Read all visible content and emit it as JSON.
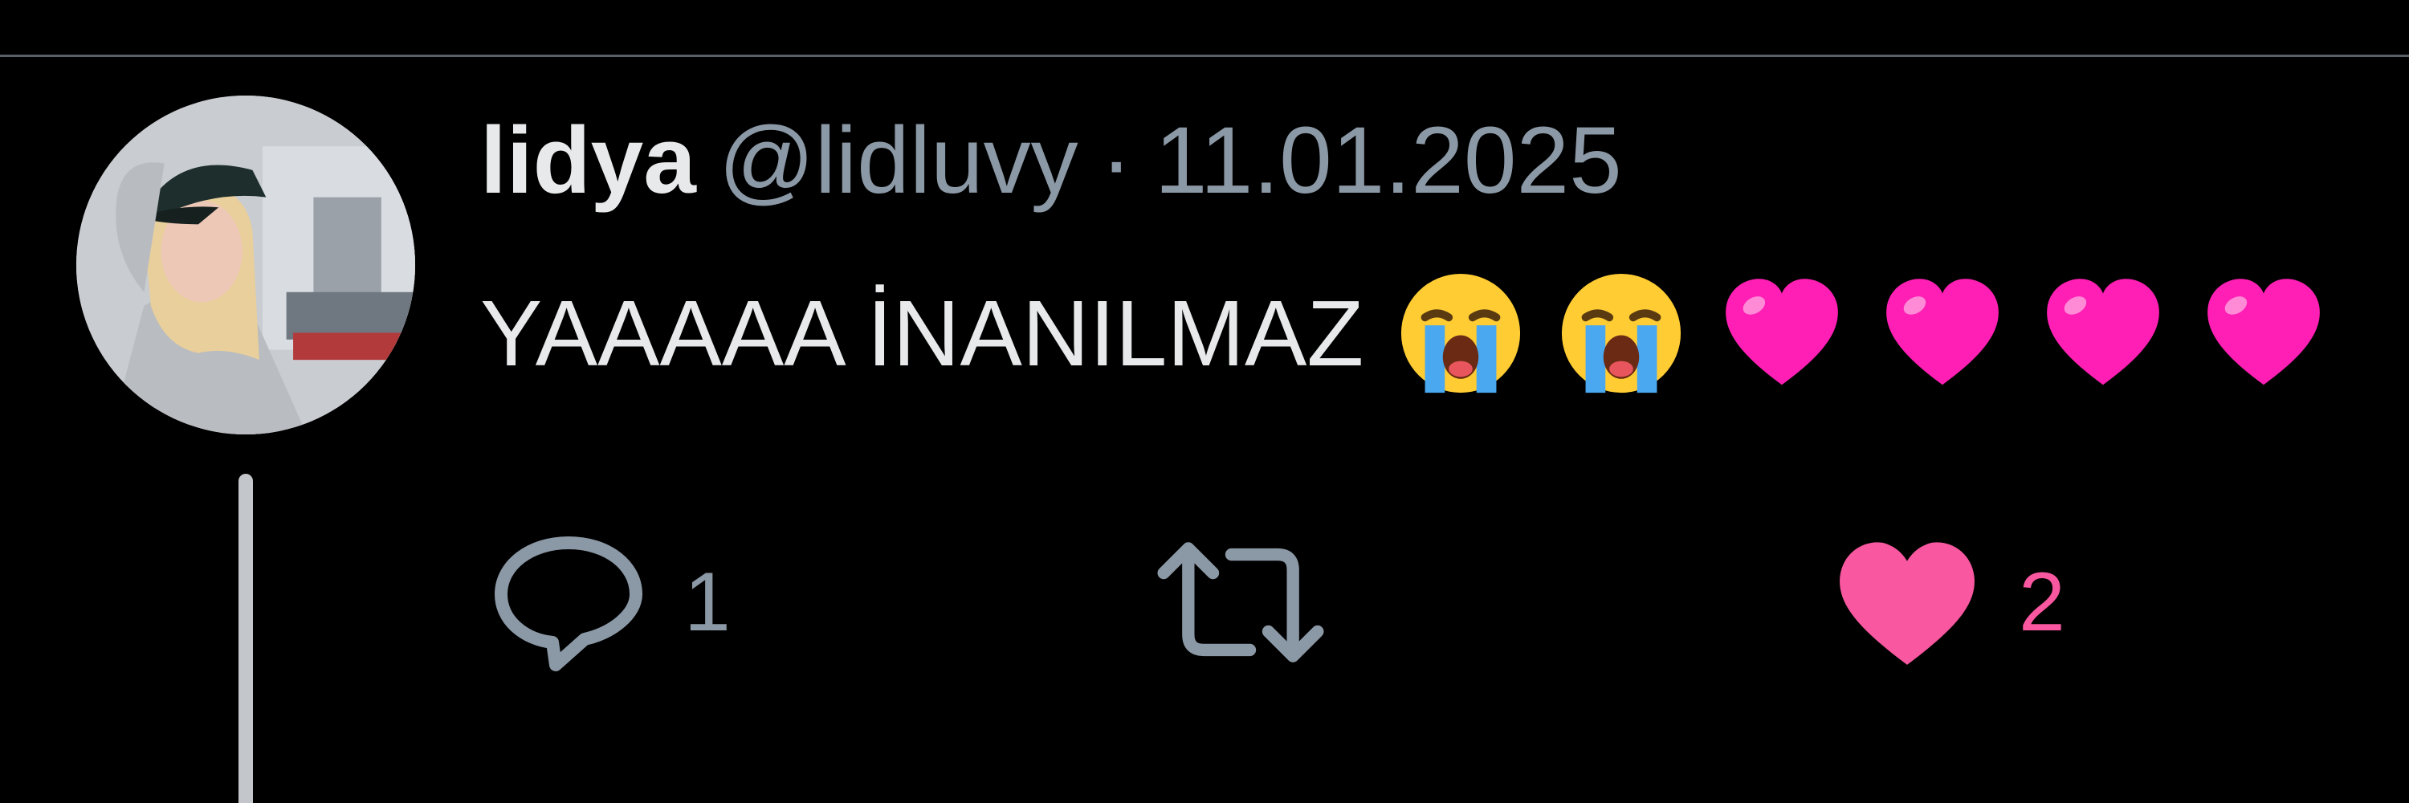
{
  "tweet": {
    "display_name": "lidya",
    "handle": "@lidluvy",
    "separator": "·",
    "date": "11.01.2025",
    "text": "YAAAAA İNANILMAZ",
    "emojis": [
      "loudly-crying-face",
      "loudly-crying-face",
      "pink-heart",
      "pink-heart",
      "pink-heart",
      "pink-heart"
    ]
  },
  "actions": {
    "reply_count": "1",
    "retweet_count": "",
    "like_count": "2"
  },
  "colors": {
    "background": "#000000",
    "primary_text": "#e7e9ea",
    "secondary_text": "#8b98a5",
    "like_pink": "#f9579f",
    "divider": "#5a5f66"
  }
}
